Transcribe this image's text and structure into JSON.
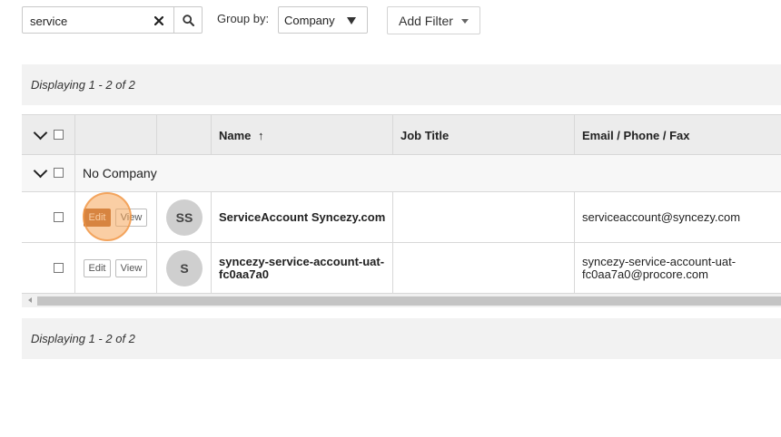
{
  "toolbar": {
    "search_value": "service",
    "groupby_label": "Group by:",
    "groupby_value": "Company",
    "add_filter_label": "Add Filter"
  },
  "displaying_top": "Displaying 1 - 2 of 2",
  "displaying_bottom": "Displaying 1 - 2 of 2",
  "columns": {
    "name": "Name",
    "sort_arrow": "↑",
    "job_title": "Job Title",
    "contact": "Email / Phone / Fax"
  },
  "group": {
    "label": "No Company"
  },
  "row_buttons": {
    "edit": "Edit",
    "view": "View"
  },
  "rows": [
    {
      "avatar": "SS",
      "name_line1": "ServiceAccount Syncezy.com",
      "name_line2": "",
      "job_title": "",
      "contact_line1": "serviceaccount@syncezy.com",
      "contact_line2": ""
    },
    {
      "avatar": "S",
      "name_line1": "syncezy-service-account-uat-",
      "name_line2": "fc0aa7a0",
      "job_title": "",
      "contact_line1": "syncezy-service-account-uat-",
      "contact_line2": "fc0aa7a0@procore.com"
    }
  ],
  "colors": {
    "edit_active": "#b25c22",
    "click_highlight": "#f5a65a",
    "header_bg": "#ececec",
    "display_bar_bg": "#f2f2f2"
  },
  "icons": [
    "clear-x-icon",
    "search-icon",
    "dropdown-caret-icon",
    "chevron-down-icon",
    "checkbox-icon",
    "scroll-left-arrow-icon"
  ]
}
